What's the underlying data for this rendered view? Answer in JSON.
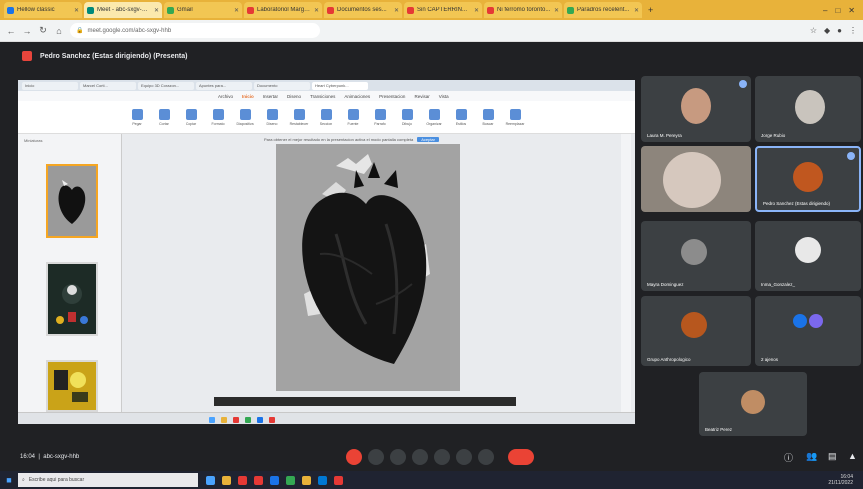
{
  "browser": {
    "tabs": [
      {
        "label": "Hellow classic",
        "color": "#1a73e8"
      },
      {
        "label": "Meet - abc-sxgv-hhb",
        "color": "#00897b",
        "active": true
      },
      {
        "label": "Gmail",
        "color": "#34a853"
      },
      {
        "label": "Laboratoriol Margrin...",
        "color": "#e53935"
      },
      {
        "label": "Documentos ses...",
        "color": "#e53935"
      },
      {
        "label": "Sin CAPTERRIN...",
        "color": "#e53935"
      },
      {
        "label": "Ni ferromo toronto...",
        "color": "#e53935"
      },
      {
        "label": "Paradros recelent...",
        "color": "#34a853"
      }
    ],
    "new_tab": "+",
    "url": "meet.google.com/abc-sxgv-hhb"
  },
  "meet": {
    "presenter_title": "Pedro Sanchez (Estas dirigiendo) (Presenta)",
    "meeting_time": "16:04",
    "meeting_code": "abc-sxgv-hhb"
  },
  "shared_screen": {
    "tabs": [
      "Inicio",
      "Marcel Corti...",
      "Equipo 3D Corazon...",
      "Apuntes para...",
      "Documento",
      "Heart Cyberpunk..."
    ],
    "menu": [
      "Archivo",
      "Inicio",
      "Insertar",
      "Diseno",
      "Transiciones",
      "Animaciones",
      "Presentacion",
      "Revisar",
      "Vista"
    ],
    "active_menu": "Inicio",
    "ribbon": [
      "Pegar",
      "Cortar",
      "Copiar",
      "Formato",
      "Diapositiva",
      "Diseno",
      "Restablecer",
      "Seccion",
      "Fuente",
      "Parrafo",
      "Dibujo",
      "Organizar",
      "Estilos",
      "Buscar",
      "Reemplazar"
    ],
    "panel_label": "Miniaturas",
    "notice_text": "Para obtener el mejor resultado en la presentacion activa el modo pantalla completa",
    "notice_button": "Aceptar"
  },
  "participants": [
    {
      "name": "Laura M. Pereyra",
      "bg": "#7a6a5a"
    },
    {
      "name": "Jorge Rubio",
      "bg": "#5c5c58"
    },
    {
      "name": "",
      "bg": "#8d857c"
    },
    {
      "name": "Pedro Sanchez (Estas dirigiendo)",
      "bg": "#2d2b33"
    },
    {
      "name": "Mayra Dominguez",
      "bg": "#3c4043"
    },
    {
      "name": "Inma_Gonzalez_",
      "bg": "#3c4043"
    },
    {
      "name": "Grupo Anthropologico",
      "bg": "#3c4043"
    },
    {
      "name": "2 ajenos",
      "bg": "#3c4043"
    },
    {
      "name": "Beatriz Perez",
      "bg": "#6e7b6a"
    }
  ],
  "taskbar": {
    "search_placeholder": "Escribe aqui para buscar",
    "time": "16:04",
    "date": "21/11/2022"
  },
  "colors": {
    "accent": "#e8b23a",
    "meet_bg": "#202124",
    "hangup": "#ea4335"
  }
}
